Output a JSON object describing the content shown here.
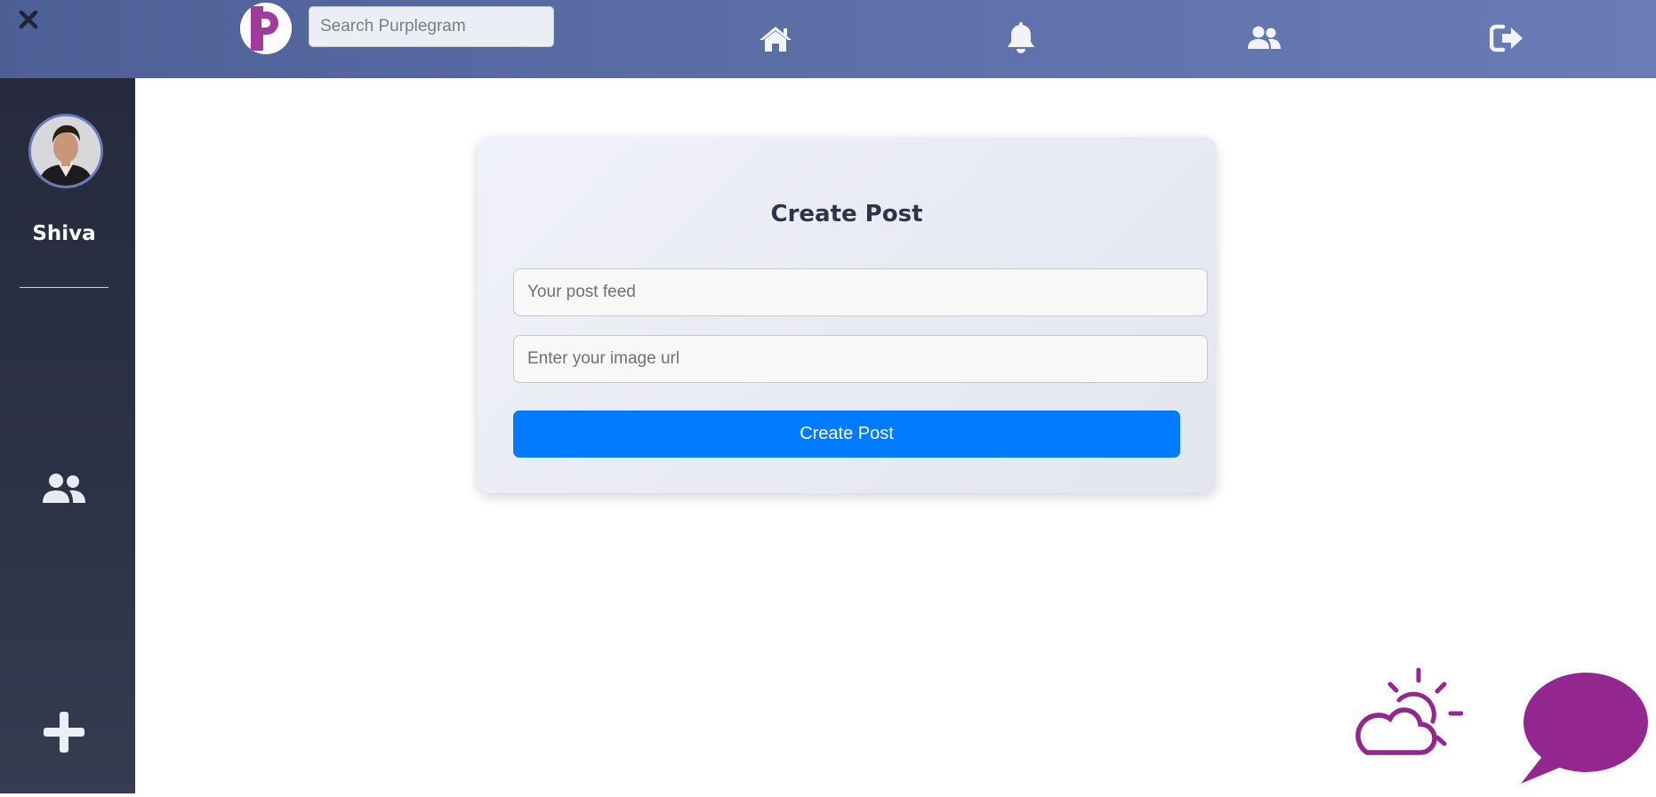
{
  "topbar": {
    "search_placeholder": "Search Purplegram",
    "logo_letter": "p",
    "nav": [
      "home-icon",
      "bell-icon",
      "users-icon",
      "sign-out-icon"
    ]
  },
  "sidebar": {
    "username": "Shiva",
    "icons": [
      "users-icon",
      "plus-icon"
    ]
  },
  "create_post": {
    "title": "Create Post",
    "feed_placeholder": "Your post feed",
    "image_placeholder": "Enter your image url",
    "submit_label": "Create Post"
  },
  "floating": [
    "weather-icon",
    "chat-bubble-icon"
  ],
  "colors": {
    "topbar": "#5d6fa7",
    "sidebar": "#2d3347",
    "primary_button": "#007bff",
    "accent_purple": "#93278f",
    "logo_purple": "#a03a9b"
  }
}
